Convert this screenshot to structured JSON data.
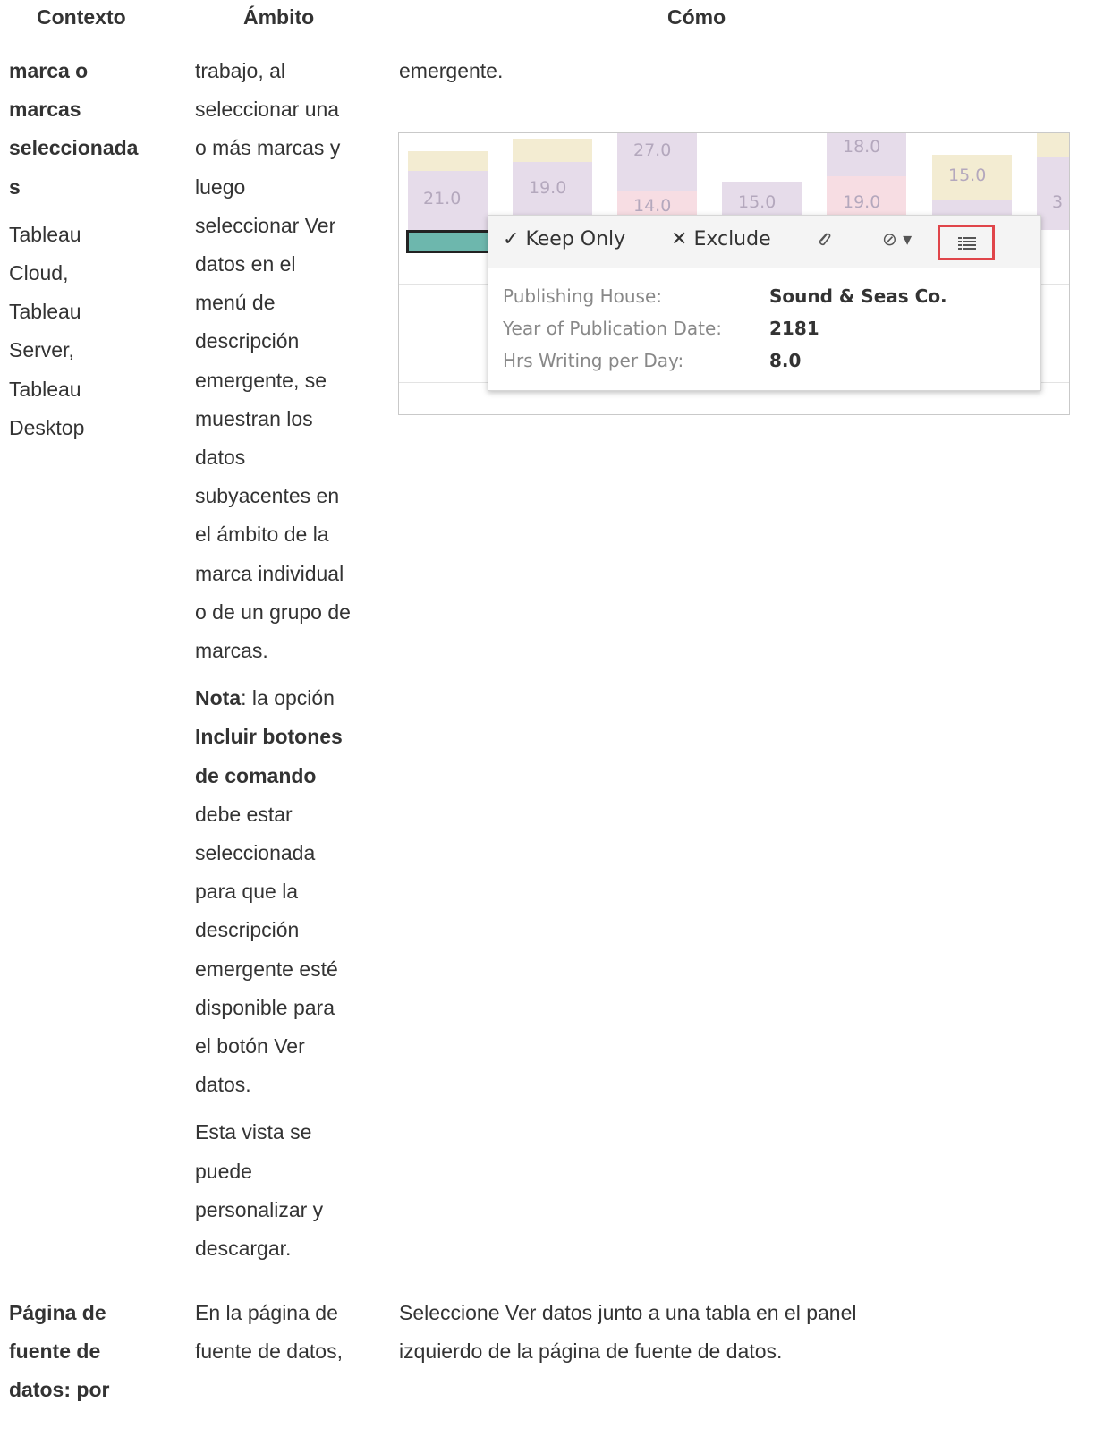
{
  "headers": {
    "context": "Contexto",
    "scope": "Ámbito",
    "how": "Cómo"
  },
  "row1": {
    "context_bold_lines": [
      "marca o",
      "marcas",
      "seleccionada",
      "s"
    ],
    "context_plain_lines": [
      "Tableau",
      "Cloud,",
      "Tableau",
      "Server,",
      "Tableau",
      "Desktop"
    ],
    "scope_p1_lines": [
      "trabajo, al",
      "seleccionar una",
      "o más marcas y",
      "luego",
      "seleccionar Ver",
      "datos en el",
      "menú de",
      "descripción",
      "emergente, se",
      "muestran los",
      "datos",
      "subyacentes en",
      "el ámbito de la",
      "marca individual",
      "o de un grupo de",
      "marcas."
    ],
    "scope_note": {
      "nota": "Nota",
      "colon": ": la opción",
      "bold_lines": [
        "Incluir botones",
        "de comando"
      ],
      "rest_lines": [
        "debe estar",
        "seleccionada",
        "para que la",
        "descripción",
        "emergente esté",
        "disponible para",
        "el botón Ver",
        "datos."
      ]
    },
    "scope_p3_lines": [
      "Esta vista se",
      "puede",
      "personalizar y",
      "descargar."
    ],
    "how_text": "emergente."
  },
  "figure": {
    "bar_labels": [
      "21.0",
      "19.0",
      "27.0",
      "14.0",
      "15.0",
      "18.0",
      "19.0",
      "15.0",
      "3"
    ],
    "colors": {
      "purple": "#e6dcea",
      "beige": "#f3ecd2",
      "pink": "#f7dde3",
      "teal": "#6db7ad",
      "highlight": "#e0454a"
    },
    "toolbar": {
      "keep_only": "Keep Only",
      "exclude": "Exclude",
      "check_icon": "✓",
      "x_icon": "✕",
      "link_icon": "🔗",
      "group_icon": "⊘",
      "dropdown_icon": "▾"
    },
    "tooltip_rows": [
      {
        "label": "Publishing House:",
        "value": "Sound & Seas Co."
      },
      {
        "label": "Year of Publication Date:",
        "value": "2181"
      },
      {
        "label": "Hrs Writing per Day:",
        "value": "8.0"
      }
    ]
  },
  "row2": {
    "context_lines": [
      "Página de",
      "fuente de",
      "datos: por"
    ],
    "scope_lines": [
      "En la página de",
      "fuente de datos,"
    ],
    "how_lines": [
      "Seleccione Ver datos junto a una tabla en el panel",
      "izquierdo de la página de fuente de datos."
    ]
  }
}
